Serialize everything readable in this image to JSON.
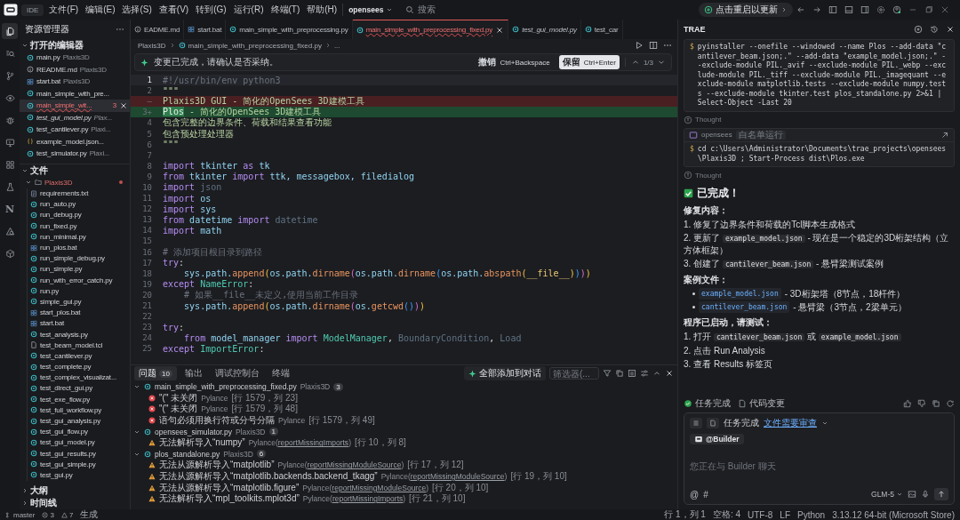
{
  "title_bar": {
    "app": "IDE",
    "menu": [
      "文件(F)",
      "编辑(E)",
      "选择(S)",
      "查看(V)",
      "转到(G)",
      "运行(R)",
      "终端(T)",
      "帮助(H)"
    ],
    "project": "opensees",
    "search": {
      "placeholder": "搜索"
    },
    "update_button": "点击重启以更新"
  },
  "activity_bar": [
    {
      "kind": "files",
      "selected": true
    },
    {
      "kind": "search",
      "selected": false
    },
    {
      "kind": "git",
      "selected": false
    },
    {
      "kind": "eye",
      "selected": false
    },
    {
      "kind": "bug",
      "selected": false
    },
    {
      "kind": "monitor",
      "selected": false
    },
    {
      "kind": "grid",
      "selected": false
    },
    {
      "kind": "flask",
      "selected": false
    },
    {
      "kind": "letter",
      "label": "N",
      "selected": false
    },
    {
      "kind": "shapes",
      "selected": false
    },
    {
      "kind": "cube",
      "selected": false
    }
  ],
  "sidebar": {
    "title": "资源管理器",
    "open_editors": {
      "title": "打开的编辑器",
      "expanded": true,
      "items": [
        {
          "name": "main.py",
          "folder": "Plaxis3D",
          "kind": "py",
          "selected": false,
          "preview": false
        },
        {
          "name": "README.md",
          "folder": "Plaxis3D",
          "kind": "md",
          "selected": false,
          "preview": false
        },
        {
          "name": "start.bat",
          "folder": "Plaxis3D",
          "kind": "bat",
          "selected": false,
          "preview": false
        },
        {
          "name": "main_simple_with_pre...",
          "kind": "py",
          "selected": false,
          "preview": false
        },
        {
          "name": "main_simple_wit...",
          "kind": "py",
          "selected": true,
          "preview": false,
          "errors": "3"
        },
        {
          "name": "test_gui_model.py",
          "folder": "Plax...",
          "kind": "py",
          "selected": false,
          "preview": true
        },
        {
          "name": "test_cantilever.py",
          "folder": "Plaxi...",
          "kind": "py",
          "selected": false,
          "preview": false
        },
        {
          "name": "example_model.json...",
          "kind": "json",
          "selected": false,
          "preview": false
        },
        {
          "name": "test_simulator.py",
          "folder": "Plaxi...",
          "kind": "py",
          "selected": false,
          "preview": false
        }
      ]
    },
    "files": {
      "title": "文件",
      "expanded": true,
      "root": {
        "name": "Plaxis3D",
        "expanded": true,
        "error": true,
        "children": [
          {
            "name": "requirements.txt",
            "kind": "txt"
          },
          {
            "name": "run_auto.py",
            "kind": "py"
          },
          {
            "name": "run_debug.py",
            "kind": "py"
          },
          {
            "name": "run_fixed.py",
            "kind": "py"
          },
          {
            "name": "run_minimal.py",
            "kind": "py"
          },
          {
            "name": "run_plos.bat",
            "kind": "bat"
          },
          {
            "name": "run_simple_debug.py",
            "kind": "py"
          },
          {
            "name": "run_simple.py",
            "kind": "py"
          },
          {
            "name": "run_with_error_catch.py",
            "kind": "py"
          },
          {
            "name": "run.py",
            "kind": "py"
          },
          {
            "name": "simple_gui.py",
            "kind": "py"
          },
          {
            "name": "start_plos.bat",
            "kind": "bat"
          },
          {
            "name": "start.bat",
            "kind": "bat"
          },
          {
            "name": "test_analysis.py",
            "kind": "py"
          },
          {
            "name": "test_beam_model.tcl",
            "kind": "tcl"
          },
          {
            "name": "test_cantilever.py",
            "kind": "py"
          },
          {
            "name": "test_complete.py",
            "kind": "py"
          },
          {
            "name": "test_complex_visualizat...",
            "kind": "py"
          },
          {
            "name": "test_direct_gui.py",
            "kind": "py"
          },
          {
            "name": "test_exe_flow.py",
            "kind": "py"
          },
          {
            "name": "test_full_workflow.py",
            "kind": "py"
          },
          {
            "name": "test_gui_analysis.py",
            "kind": "py"
          },
          {
            "name": "test_gui_flow.py",
            "kind": "py"
          },
          {
            "name": "test_gui_model.py",
            "kind": "py"
          },
          {
            "name": "test_gui_results.py",
            "kind": "py"
          },
          {
            "name": "test_gui_simple.py",
            "kind": "py"
          },
          {
            "name": "test_gui.py",
            "kind": "py"
          }
        ]
      }
    },
    "sections": [
      {
        "title": "大纲",
        "expanded": false
      },
      {
        "title": "时间线",
        "expanded": false
      }
    ]
  },
  "editor": {
    "tabs": [
      {
        "label": "EADME.md",
        "kind": "md",
        "selected": false,
        "preview": false,
        "error": false
      },
      {
        "label": "start.bat",
        "kind": "bat",
        "selected": false,
        "preview": false,
        "error": false
      },
      {
        "label": "main_simple_with_preprocessing.py",
        "kind": "py",
        "selected": false,
        "preview": false,
        "error": false
      },
      {
        "label": "main_simple_with_preprocessing_fixed.py",
        "kind": "py",
        "selected": true,
        "preview": false,
        "error": true
      },
      {
        "label": "test_gui_model.py",
        "kind": "py",
        "selected": false,
        "preview": true,
        "error": false
      },
      {
        "label": "test_car",
        "kind": "py",
        "selected": false,
        "preview": false,
        "error": false
      }
    ],
    "breadcrumb": [
      "Plaxis3D",
      "main_simple_with_preprocessing_fixed.py",
      "..."
    ],
    "banner": {
      "message": "变更已完成，请确认是否采纳。",
      "reject": "撤销",
      "reject_key": "Ctrl+Backspace",
      "accept": "保留",
      "accept_key": "Ctrl+Enter",
      "counter": "1/3"
    },
    "lines": [
      {
        "n": "1",
        "kind": "normal",
        "current": true,
        "tokens": [
          {
            "kind": "cm",
            "text": "#!/usr/bin/env python3"
          }
        ]
      },
      {
        "n": "2",
        "kind": "normal",
        "current": false,
        "tokens": [
          {
            "kind": "str",
            "text": "\"\"\""
          }
        ]
      },
      {
        "n": "—",
        "kind": "removed",
        "current": false,
        "tokens": [
          {
            "kind": "str",
            "text": "Plaxis3D GUI - 简化的OpenSees 3D建模工具"
          }
        ]
      },
      {
        "n": "3+",
        "kind": "added",
        "current": false,
        "tokens": [
          {
            "kind": "hl",
            "text": "Plos"
          },
          {
            "kind": "str",
            "text": " - 简化的OpenSees 3D建模工具"
          }
        ]
      },
      {
        "n": "4",
        "kind": "normal",
        "current": false,
        "tokens": [
          {
            "kind": "str",
            "text": "包含完整的边界条件、荷载和结果查看功能"
          }
        ]
      },
      {
        "n": "5",
        "kind": "normal",
        "current": false,
        "tokens": [
          {
            "kind": "str",
            "text": "包含预处理处理器"
          }
        ]
      },
      {
        "n": "6",
        "kind": "normal",
        "current": false,
        "tokens": [
          {
            "kind": "str",
            "text": "\"\"\""
          }
        ]
      },
      {
        "n": "7",
        "kind": "normal",
        "current": false
      },
      {
        "n": "8",
        "kind": "normal",
        "current": false,
        "tokens": [
          {
            "kind": "kw",
            "text": "import "
          },
          {
            "kind": "mod",
            "text": "tkinter "
          },
          {
            "kind": "kw",
            "text": "as "
          },
          {
            "kind": "mod",
            "text": "tk"
          }
        ]
      },
      {
        "n": "9",
        "kind": "normal",
        "current": false,
        "tokens": [
          {
            "kind": "kw",
            "text": "from "
          },
          {
            "kind": "mod",
            "text": "tkinter "
          },
          {
            "kind": "kw",
            "text": "import "
          },
          {
            "kind": "mod",
            "text": "ttk, messagebox, filedialog"
          }
        ]
      },
      {
        "n": "10",
        "kind": "normal",
        "current": false,
        "tokens": [
          {
            "kind": "kw",
            "text": "import "
          },
          {
            "kind": "un",
            "text": "json"
          }
        ]
      },
      {
        "n": "11",
        "kind": "normal",
        "current": false,
        "tokens": [
          {
            "kind": "kw",
            "text": "import "
          },
          {
            "kind": "mod",
            "text": "os"
          }
        ]
      },
      {
        "n": "12",
        "kind": "normal",
        "current": false,
        "tokens": [
          {
            "kind": "kw",
            "text": "import "
          },
          {
            "kind": "mod",
            "text": "sys"
          }
        ]
      },
      {
        "n": "13",
        "kind": "normal",
        "current": false,
        "tokens": [
          {
            "kind": "kw",
            "text": "from "
          },
          {
            "kind": "mod",
            "text": "datetime "
          },
          {
            "kind": "kw",
            "text": "import "
          },
          {
            "kind": "un",
            "text": "datetime"
          }
        ]
      },
      {
        "n": "14",
        "kind": "normal",
        "current": false,
        "tokens": [
          {
            "kind": "kw",
            "text": "import "
          },
          {
            "kind": "mod",
            "text": "math"
          }
        ]
      },
      {
        "n": "15",
        "kind": "normal",
        "current": false
      },
      {
        "n": "16",
        "kind": "normal",
        "current": false,
        "tokens": [
          {
            "kind": "cm",
            "text": "# 添加项目根目录到路径"
          }
        ]
      },
      {
        "n": "17",
        "kind": "normal",
        "current": false,
        "tokens": [
          {
            "kind": "kw",
            "text": "try"
          },
          {
            "kind": "p",
            "text": ":"
          }
        ]
      },
      {
        "n": "18",
        "kind": "normal",
        "current": false,
        "tokens": [
          {
            "kind": "mod",
            "text": "    sys.path."
          },
          {
            "kind": "fn",
            "text": "append"
          },
          {
            "kind": "b1",
            "text": "("
          },
          {
            "kind": "mod",
            "text": "os.path."
          },
          {
            "kind": "fn",
            "text": "dirname"
          },
          {
            "kind": "b2",
            "text": "("
          },
          {
            "kind": "mod",
            "text": "os.path."
          },
          {
            "kind": "fn",
            "text": "dirname"
          },
          {
            "kind": "b3",
            "text": "("
          },
          {
            "kind": "mod",
            "text": "os.path."
          },
          {
            "kind": "fn",
            "text": "abspath"
          },
          {
            "kind": "b1",
            "text": "("
          },
          {
            "kind": "du",
            "text": "__file__"
          },
          {
            "kind": "b1",
            "text": ")"
          },
          {
            "kind": "b3",
            "text": ")"
          },
          {
            "kind": "b2",
            "text": ")"
          },
          {
            "kind": "b1",
            "text": ")"
          }
        ]
      },
      {
        "n": "19",
        "kind": "normal",
        "current": false,
        "tokens": [
          {
            "kind": "kw",
            "text": "except "
          },
          {
            "kind": "cls",
            "text": "NameError"
          },
          {
            "kind": "p",
            "text": ":"
          }
        ]
      },
      {
        "n": "20",
        "kind": "normal",
        "current": false,
        "tokens": [
          {
            "kind": "cm",
            "text": "    # 如果__file__未定义,使用当前工作目录"
          }
        ]
      },
      {
        "n": "21",
        "kind": "normal",
        "current": false,
        "tokens": [
          {
            "kind": "mod",
            "text": "    sys.path."
          },
          {
            "kind": "fn",
            "text": "append"
          },
          {
            "kind": "b1",
            "text": "("
          },
          {
            "kind": "mod",
            "text": "os.path."
          },
          {
            "kind": "fn",
            "text": "dirname"
          },
          {
            "kind": "b2",
            "text": "("
          },
          {
            "kind": "mod",
            "text": "os."
          },
          {
            "kind": "fn",
            "text": "getcwd"
          },
          {
            "kind": "b3",
            "text": "()"
          },
          {
            "kind": "b2",
            "text": ")"
          },
          {
            "kind": "b1",
            "text": ")"
          }
        ]
      },
      {
        "n": "22",
        "kind": "normal",
        "current": false
      },
      {
        "n": "23",
        "kind": "normal",
        "current": false,
        "tokens": [
          {
            "kind": "kw",
            "text": "try"
          },
          {
            "kind": "p",
            "text": ":"
          }
        ]
      },
      {
        "n": "24",
        "kind": "normal",
        "current": false,
        "tokens": [
          {
            "kind": "kw",
            "text": "    from "
          },
          {
            "kind": "mod",
            "text": "model_manager "
          },
          {
            "kind": "kw",
            "text": "import "
          },
          {
            "kind": "cls",
            "text": "ModelManager"
          },
          {
            "kind": "p",
            "text": ", "
          },
          {
            "kind": "un",
            "text": "BoundaryCondition"
          },
          {
            "kind": "p",
            "text": ", "
          },
          {
            "kind": "un",
            "text": "Load"
          }
        ]
      },
      {
        "n": "25",
        "kind": "normal",
        "current": false,
        "tokens": [
          {
            "kind": "kw",
            "text": "except "
          },
          {
            "kind": "cls",
            "text": "ImportError"
          },
          {
            "kind": "p",
            "text": ":"
          }
        ]
      }
    ]
  },
  "panel": {
    "tabs": [
      {
        "label": "问题",
        "count": "10",
        "selected": true
      },
      {
        "label": "输出",
        "selected": false
      },
      {
        "label": "调试控制台",
        "selected": false
      },
      {
        "label": "终端",
        "selected": false
      }
    ],
    "add_all": "全部添加到对话",
    "filter": {
      "placeholder": "筛选器(..."
    },
    "groups": [
      {
        "file": "main_simple_with_preprocessing_fixed.py",
        "folder": "Plaxis3D",
        "count": "3",
        "expanded": true,
        "items": [
          {
            "kind": "error",
            "message": "\"(\" 未关闭",
            "source": "Pylance",
            "location": "[行 1579，列 23]"
          },
          {
            "kind": "error",
            "message": "\"(\" 未关闭",
            "source": "Pylance",
            "location": "[行 1579，列 48]"
          },
          {
            "kind": "error",
            "message": "语句必须用换行符或分号分隔",
            "source": "Pylance",
            "location": "[行 1579，列 49]"
          }
        ]
      },
      {
        "file": "opensees_simulator.py",
        "folder": "Plaxis3D",
        "count": "1",
        "expanded": true,
        "items": [
          {
            "kind": "warning",
            "message": "无法解析导入“numpy”",
            "source": "Pylance(",
            "code": "reportMissingImports",
            "close": ")",
            "location": "[行 10，列 8]"
          }
        ]
      },
      {
        "file": "plos_standalone.py",
        "folder": "Plaxis3D",
        "count": "6",
        "expanded": true,
        "items": [
          {
            "kind": "warning",
            "message": "无法从源解析导入“matplotlib”",
            "source": "Pylance(",
            "code": "reportMissingModuleSource",
            "close": ")",
            "location": "[行 17，列 12]"
          },
          {
            "kind": "warning",
            "message": "无法从源解析导入“matplotlib.backends.backend_tkagg”",
            "source": "Pylance(",
            "code": "reportMissingModuleSource",
            "close": ")",
            "location": "[行 19，列 10]"
          },
          {
            "kind": "warning",
            "message": "无法从源解析导入“matplotlib.figure”",
            "source": "Pylance(",
            "code": "reportMissingModuleSource",
            "close": ")",
            "location": "[行 20，列 10]"
          },
          {
            "kind": "warning",
            "message": "无法解析导入“mpl_toolkits.mplot3d”",
            "source": "Pylance(",
            "code": "reportMissingImports",
            "close": ")",
            "location": "[行 21，列 10]"
          }
        ]
      }
    ]
  },
  "assistant": {
    "title": "TRAE",
    "messages": [
      {
        "kind": "command",
        "prompt": "$",
        "text": "pyinstaller --onefile --windowed --name Plos --add-data \"cantilever_beam.json;.\" --add-data \"example_model.json;.\" --exclude-module PIL._avif --exclude-module PIL._webp --exclude-module PIL._tiff --exclude-module PIL._imagequant --exclude-module matplotlib.tests --exclude-module numpy.tests --exclude-module tkinter.test plos_standalone.py 2>&1 | Select-Object -Last 20"
      },
      {
        "kind": "thought",
        "text": "Thought"
      },
      {
        "kind": "command",
        "prompt": "$",
        "tool": "opensees",
        "badge": "白名单运行",
        "text": "cd c:\\Users\\Administrator\\Documents\\trae_projects\\opensees\\Plaxis3D ; Start-Process dist\\Plos.exe"
      },
      {
        "kind": "thought",
        "text": "Thought"
      },
      {
        "kind": "heading",
        "text": "已完成！"
      },
      {
        "kind": "label",
        "text": "修复内容："
      },
      {
        "kind": "item",
        "marker": "1.",
        "parts": [
          {
            "kind": "text",
            "text": "修复了边界条件和荷载的Tcl脚本生成格式"
          }
        ]
      },
      {
        "kind": "item",
        "marker": "2.",
        "parts": [
          {
            "kind": "text",
            "text": "更新了 "
          },
          {
            "kind": "code",
            "text": "example_model.json"
          },
          {
            "kind": "text",
            "text": " - 现在是一个稳定的3D桁架结构（立方体框架）"
          }
        ]
      },
      {
        "kind": "item",
        "marker": "3.",
        "parts": [
          {
            "kind": "text",
            "text": "创建了 "
          },
          {
            "kind": "code",
            "text": "cantilever_beam.json"
          },
          {
            "kind": "text",
            "text": " - 悬臂梁测试案例"
          }
        ]
      },
      {
        "kind": "label",
        "text": "案例文件："
      },
      {
        "kind": "bullet",
        "parts": [
          {
            "kind": "link",
            "text": "example_model.json"
          },
          {
            "kind": "text",
            "text": " - 3D桁架塔（8节点，18杆件）"
          }
        ]
      },
      {
        "kind": "bullet",
        "parts": [
          {
            "kind": "link",
            "text": "cantilever_beam.json"
          },
          {
            "kind": "text",
            "text": " - 悬臂梁（3节点，2梁单元）"
          }
        ]
      },
      {
        "kind": "label",
        "text": "程序已启动，请测试："
      },
      {
        "kind": "item",
        "marker": "1.",
        "parts": [
          {
            "kind": "text",
            "text": "打开 "
          },
          {
            "kind": "code",
            "text": "cantilever_beam.json"
          },
          {
            "kind": "text",
            "text": " 或 "
          },
          {
            "kind": "code",
            "text": "example_model.json"
          }
        ]
      },
      {
        "kind": "item",
        "marker": "2.",
        "parts": [
          {
            "kind": "text",
            "text": "点击 Run Analysis"
          }
        ]
      },
      {
        "kind": "item",
        "marker": "3.",
        "parts": [
          {
            "kind": "text",
            "text": "查看 Results 标签页"
          }
        ]
      }
    ],
    "task_bar": {
      "status": "任务完成",
      "changes": "代码变更"
    },
    "composer": {
      "status": "任务完成",
      "review_link": "文件需要审查",
      "agent": "@Builder",
      "placeholder": "您正在与 Builder 聊天",
      "tools": [
        "@",
        "#"
      ],
      "model": "GLM-5"
    }
  },
  "status_bar": {
    "branch": "master",
    "errors": "3",
    "warnings": "7",
    "left": [
      "生成"
    ],
    "right": [
      "行 1，列 1",
      "空格: 4",
      "UTF-8",
      "LF",
      "Python",
      "3.13.12 64-bit (Microsoft Store)"
    ]
  }
}
